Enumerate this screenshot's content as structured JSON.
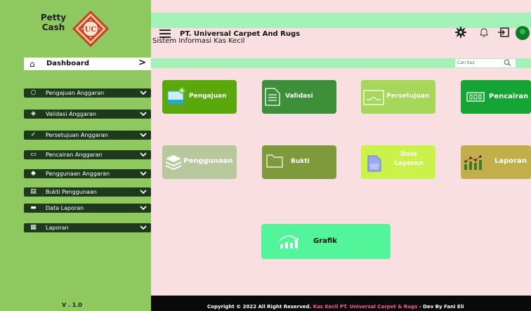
{
  "brand": {
    "line1": "Petty",
    "line2": "Cash",
    "logo_text": "UC"
  },
  "sidebar": {
    "dashboard_label": "Dashboard",
    "dashboard_arrow": ">",
    "items": [
      {
        "label": "Pengajuan Anggaran"
      },
      {
        "label": "Validasi Anggaran"
      },
      {
        "label": "Persetujuan Anggaran"
      },
      {
        "label": "Pencairan Anggaran"
      },
      {
        "label": "Penggunaan Anggaran"
      },
      {
        "label": "Bukti Penggunaan"
      },
      {
        "label": "Data Laporan"
      },
      {
        "label": "Laporan"
      }
    ],
    "version": "V . 1.0"
  },
  "header": {
    "company": "PT. Universal Carpet And Rugs",
    "subtitle": "Sistem Informasi Kas Kecil"
  },
  "search": {
    "placeholder": "Cari Kas"
  },
  "cards": [
    {
      "label": "Pengajuan",
      "color": "#5aa80c"
    },
    {
      "label": "Validasi",
      "color": "#3e8f3a"
    },
    {
      "label": "Persetujuan",
      "color": "#a6d65a"
    },
    {
      "label": "Pencairan",
      "color": "#16a535"
    },
    {
      "label": "Penggunaan",
      "color": "#b7c89c"
    },
    {
      "label": "Bukti",
      "color": "#7e9a3a"
    },
    {
      "label_line1": "Data",
      "label_line2": "Laporan",
      "color": "#caf24a"
    },
    {
      "label": "Laporan",
      "color": "#c2ae4a"
    },
    {
      "label": "Grafik",
      "color": "#52f59a"
    }
  ],
  "footer": {
    "copyright": "Copyright",
    "copy_symbol": "©",
    "text1": "2022 All Right Reserved.",
    "highlight": "Kas Kecil PT. Universal Carpet & Rugs",
    "text2": "- Dev By Fani Eli"
  }
}
